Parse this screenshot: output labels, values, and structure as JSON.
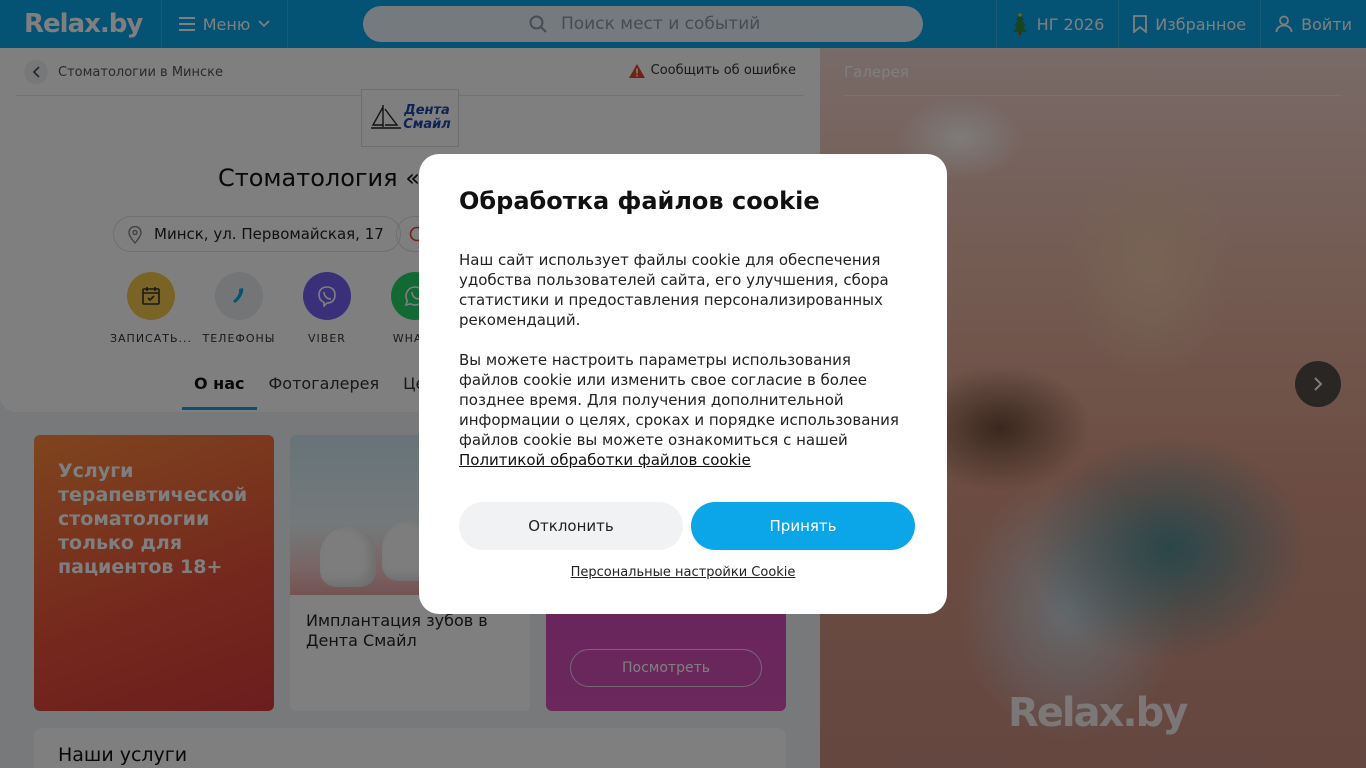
{
  "header": {
    "logo": "Relax.by",
    "menu_label": "Меню",
    "search_placeholder": "Поиск мест и событий",
    "ng_label": "НГ 2026",
    "favorites_label": "Избранное",
    "login_label": "Войти"
  },
  "page": {
    "breadcrumb": "Стоматологии в Минске",
    "report_label": "Сообщить об ошибке",
    "brand_logo_line1": "Дента",
    "brand_logo_line2": "Смайл",
    "title": "Стоматология «",
    "address": "Минск, ул. Первомайская, 17",
    "actions": [
      {
        "label": "ЗАПИСАТЬ...",
        "icon": "calendar-icon",
        "color": "#f2c94c"
      },
      {
        "label": "ТЕЛЕФОНЫ",
        "icon": "phone-icon",
        "color": "#e8eaed"
      },
      {
        "label": "VIBER",
        "icon": "viber-icon",
        "color": "#7360f2"
      },
      {
        "label": "WHATS",
        "icon": "whatsapp-icon",
        "color": "#25d366"
      }
    ],
    "tabs": [
      "О нас",
      "Фотогалерея",
      "Цен"
    ],
    "promos": {
      "promo1_text": "Услуги терапевтической стоматологии только для пациентов 18+",
      "promo2_caption": "Имплантация зубов в Дента Смайл",
      "promo3_button": "Посмотреть"
    },
    "services_title": "Наши услуги"
  },
  "gallery": {
    "title": "Галерея",
    "watermark": "Relax.by"
  },
  "cookie_modal": {
    "title": "Обработка файлов cookie",
    "paragraph1": "Наш сайт использует файлы cookie для обеспечения удобства пользователей сайта, его улучшения, сбора статистики и предоставления персонализированных рекомендаций.",
    "paragraph2": "Вы можете настроить параметры использования файлов cookie или изменить свое согласие в более позднее время. Для получения дополнительной информации о целях, сроках и порядке использования файлов cookie вы можете ознакомиться с нашей",
    "policy_link": "Политикой обработки файлов cookie",
    "decline_label": "Отклонить",
    "accept_label": "Принять",
    "settings_link": "Персональные настройки Cookie"
  },
  "colors": {
    "brand": "#0aa6e8",
    "overlay": "rgba(0,0,0,0.5)"
  }
}
